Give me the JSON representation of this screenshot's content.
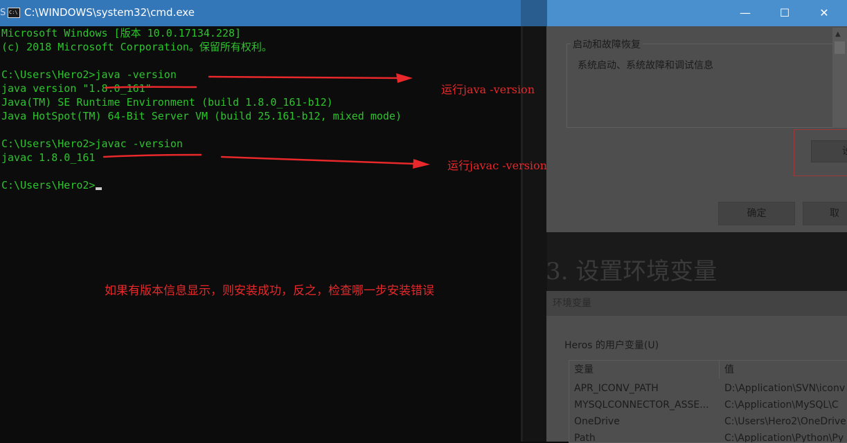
{
  "cmd": {
    "title": "C:\\WINDOWS\\system32\\cmd.exe",
    "icon_label": "C:\\",
    "controls": {
      "minimize": "—",
      "maximize": "☐",
      "close": "✕"
    },
    "lines": [
      "Microsoft Windows [版本 10.0.17134.228]",
      "(c) 2018 Microsoft Corporation。保留所有权利。",
      "",
      "C:\\Users\\Hero2>java -version",
      "java version \"1.8.0_161\"",
      "Java(TM) SE Runtime Environment (build 1.8.0_161-b12)",
      "Java HotSpot(TM) 64-Bit Server VM (build 25.161-b12, mixed mode)",
      "",
      "C:\\Users\\Hero2>javac -version",
      "javac 1.8.0_161",
      "",
      "C:\\Users\\Hero2>"
    ],
    "text_color": "#2ec42e",
    "background": "#0c0c0c"
  },
  "annotations": {
    "java": "运行java -version",
    "javac": "运行javac -version",
    "note": "如果有版本信息显示，则安装成功，反之，检查哪一步安装错误",
    "color": "#e8282a"
  },
  "background_doc": {
    "startup_group_title": "启动和故障恢复",
    "startup_group_desc": "系统启动、系统故障和调试信息",
    "settings_button": "设",
    "ok_button": "确定",
    "cancel_button": "取消",
    "section_heading": "3. 设置环境变量",
    "env_dialog_title": "环境变量",
    "user_vars_label": "Heros 的用户变量(U)",
    "table": {
      "headers": [
        "变量",
        "值"
      ],
      "rows": [
        [
          "APR_ICONV_PATH",
          "D:\\Application\\SVN\\iconv"
        ],
        [
          "MYSQLCONNECTOR_ASSE...",
          "C:\\Application\\MySQL\\C"
        ],
        [
          "OneDrive",
          "C:\\Users\\Hero2\\OneDrive"
        ],
        [
          "Path",
          "C:\\Application\\Python\\Py"
        ]
      ]
    }
  }
}
